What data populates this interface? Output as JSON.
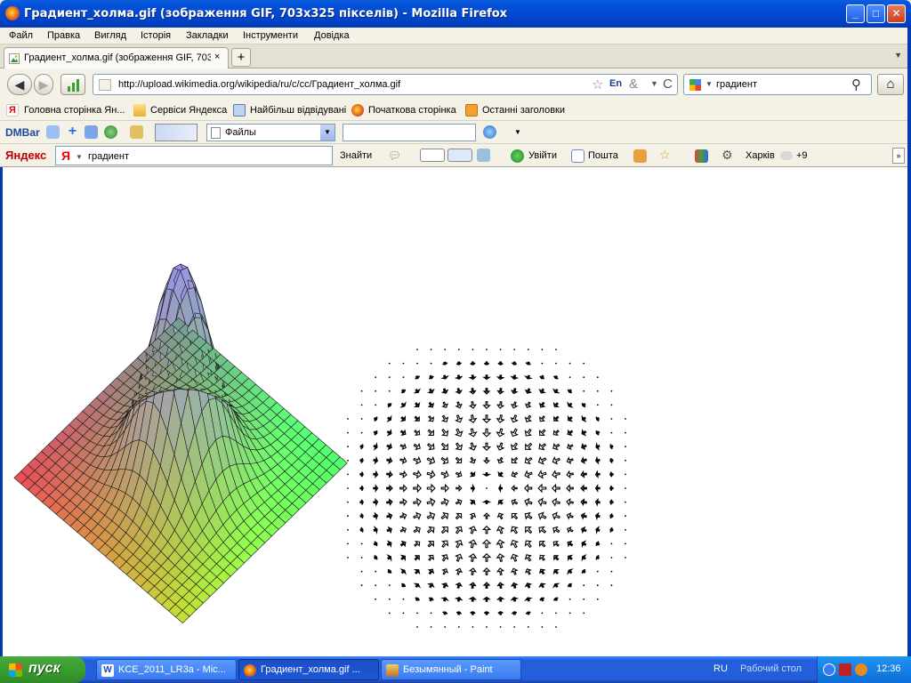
{
  "window": {
    "title": "Градиент_холма.gif (зображення GIF, 703x325 пікселів) - Mozilla Firefox",
    "min": "_",
    "max": "□",
    "close": "✕"
  },
  "menu": [
    "Файл",
    "Правка",
    "Вигляд",
    "Історія",
    "Закладки",
    "Інструменти",
    "Довідка"
  ],
  "tab": {
    "label": "Градиент_холма.gif (зображення GIF, 703...",
    "close": "×",
    "new": "+",
    "list": "▼"
  },
  "nav": {
    "back": "◀",
    "forward": "▶",
    "url": "http://upload.wikimedia.org/wikipedia/ru/c/cc/Градиент_холма.gif",
    "lang": "En",
    "reload": "C",
    "search": "градиент",
    "home": "⌂"
  },
  "bookmarks": [
    "Головна сторінка Ян...",
    "Сервіси Яндекса",
    "Найбільш відвідувані",
    "Початкова сторінка",
    "Останні заголовки"
  ],
  "dmbar": {
    "logo": "DMBar",
    "files": "Файлы"
  },
  "yandex": {
    "logo": "Яндекс",
    "query": "градиент",
    "find": "Знайти",
    "login": "Увійти",
    "mail": "Пошта",
    "city": "Харків",
    "temp": "+9"
  },
  "taskbar": {
    "start": "пуск",
    "tasks": [
      "KCE_2011_LR3a - Mic...",
      "Градиент_холма.gif ...",
      "Безымянный - Paint"
    ],
    "lang": "RU",
    "desktop": "Рабочий стол",
    "clock": "12:36"
  },
  "colors": {
    "titlebar": "#0550d8",
    "taskbar": "#245edb",
    "start": "#389a2e",
    "chrome": "#f4f1e6"
  }
}
